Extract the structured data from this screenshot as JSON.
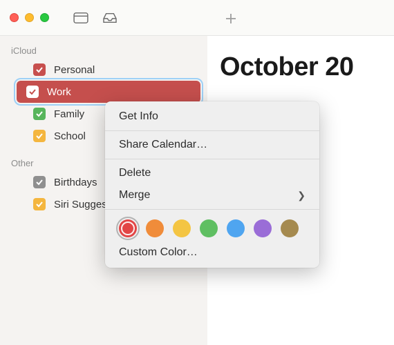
{
  "sidebar": {
    "sections": [
      {
        "title": "iCloud",
        "items": [
          {
            "label": "Personal",
            "color": "#c74f4d",
            "checked": true,
            "selected": false
          },
          {
            "label": "Work",
            "color": "#ffffff",
            "bg": "#c54f4d",
            "checked": true,
            "selected": true
          },
          {
            "label": "Family",
            "color": "#57b55b",
            "checked": true,
            "selected": false
          },
          {
            "label": "School",
            "color": "#f4b63f",
            "checked": true,
            "selected": false
          }
        ]
      },
      {
        "title": "Other",
        "items": [
          {
            "label": "Birthdays",
            "color": "#8f8f8f",
            "checked": true,
            "selected": false
          },
          {
            "label": "Siri Suggestions",
            "color": "#f4b63f",
            "checked": true,
            "selected": false
          }
        ]
      }
    ]
  },
  "main": {
    "month_title": "October 20"
  },
  "context_menu": {
    "get_info": "Get Info",
    "share": "Share Calendar…",
    "delete": "Delete",
    "merge": "Merge",
    "custom_color": "Custom Color…",
    "colors": [
      {
        "name": "red",
        "hex": "#e24545",
        "selected": true
      },
      {
        "name": "orange",
        "hex": "#f08c3a",
        "selected": false
      },
      {
        "name": "yellow",
        "hex": "#f4c543",
        "selected": false
      },
      {
        "name": "green",
        "hex": "#5fbf62",
        "selected": false
      },
      {
        "name": "blue",
        "hex": "#4fa5f0",
        "selected": false
      },
      {
        "name": "purple",
        "hex": "#9a6dd7",
        "selected": false
      },
      {
        "name": "brown",
        "hex": "#a58a4f",
        "selected": false
      }
    ]
  }
}
